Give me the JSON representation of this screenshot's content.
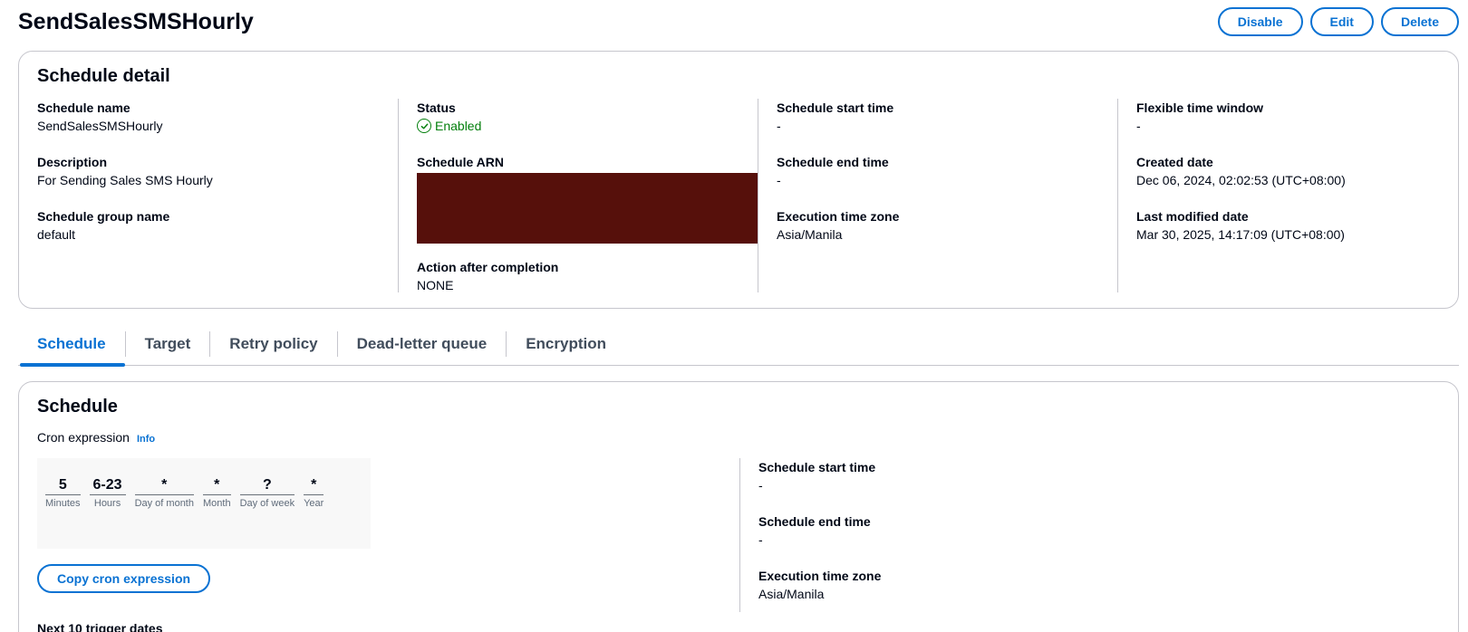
{
  "page": {
    "title": "SendSalesSMSHourly",
    "actions": {
      "disable": "Disable",
      "edit": "Edit",
      "delete": "Delete"
    }
  },
  "detail": {
    "heading": "Schedule detail",
    "schedule_name": {
      "label": "Schedule name",
      "value": "SendSalesSMSHourly"
    },
    "description": {
      "label": "Description",
      "value": "For Sending Sales SMS Hourly"
    },
    "group_name": {
      "label": "Schedule group name",
      "value": "default"
    },
    "status": {
      "label": "Status",
      "value": "Enabled",
      "color": "#037f0c"
    },
    "arn": {
      "label": "Schedule ARN",
      "redaction_color": "#56100b"
    },
    "action_after": {
      "label": "Action after completion",
      "value": "NONE"
    },
    "start_time": {
      "label": "Schedule start time",
      "value": "-"
    },
    "end_time": {
      "label": "Schedule end time",
      "value": "-"
    },
    "time_zone": {
      "label": "Execution time zone",
      "value": "Asia/Manila"
    },
    "flex_window": {
      "label": "Flexible time window",
      "value": "-"
    },
    "created": {
      "label": "Created date",
      "value": "Dec 06, 2024, 02:02:53 (UTC+08:00)"
    },
    "modified": {
      "label": "Last modified date",
      "value": "Mar 30, 2025, 14:17:09 (UTC+08:00)"
    }
  },
  "tabs": [
    {
      "label": "Schedule",
      "active": true
    },
    {
      "label": "Target"
    },
    {
      "label": "Retry policy"
    },
    {
      "label": "Dead-letter queue"
    },
    {
      "label": "Encryption"
    }
  ],
  "schedule": {
    "heading": "Schedule",
    "cron_label": "Cron expression",
    "info": "Info",
    "cron_fields": [
      {
        "value": "5",
        "unit": "Minutes"
      },
      {
        "value": "6-23",
        "unit": "Hours"
      },
      {
        "value": "*",
        "unit": "Day of month"
      },
      {
        "value": "*",
        "unit": "Month"
      },
      {
        "value": "?",
        "unit": "Day of week"
      },
      {
        "value": "*",
        "unit": "Year"
      }
    ],
    "copy_button": "Copy cron expression",
    "next_label": "Next 10 trigger dates",
    "start_time": {
      "label": "Schedule start time",
      "value": "-"
    },
    "end_time": {
      "label": "Schedule end time",
      "value": "-"
    },
    "time_zone": {
      "label": "Execution time zone",
      "value": "Asia/Manila"
    }
  },
  "colors": {
    "accent": "#0972d3",
    "border": "#c6c6cd",
    "success": "#037f0c"
  }
}
